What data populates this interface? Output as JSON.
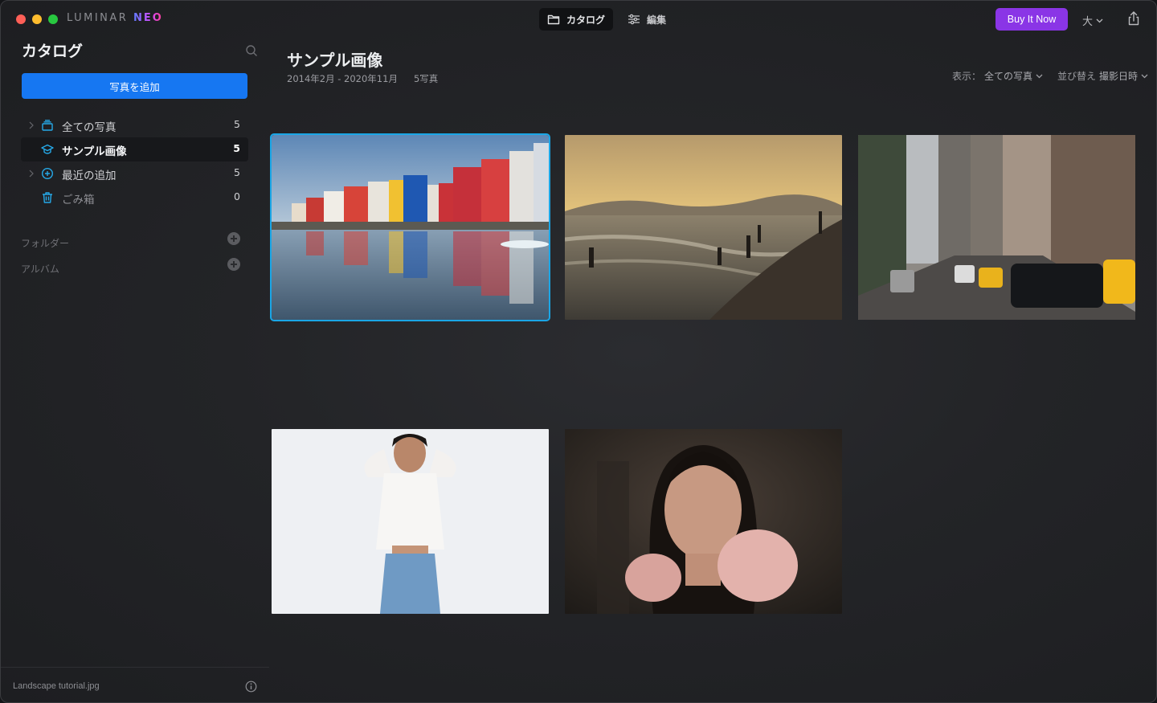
{
  "app": {
    "logo_main": "LUMINAR",
    "logo_neo": "NEO"
  },
  "toolbar": {
    "tabs": [
      {
        "label": "カタログ",
        "icon": "folder-icon",
        "active": true
      },
      {
        "label": "編集",
        "icon": "sliders-icon",
        "active": false
      }
    ],
    "buy_label": "Buy It Now",
    "size_label": "大"
  },
  "sidebar": {
    "title": "カタログ",
    "add_photo_label": "写真を追加",
    "items": [
      {
        "label": "全ての写真",
        "count": "5",
        "icon": "photos-stack-icon"
      },
      {
        "label": "サンプル画像",
        "count": "5",
        "icon": "graduation-cap-icon"
      },
      {
        "label": "最近の追加",
        "count": "5",
        "icon": "plus-circle-icon"
      },
      {
        "label": "ごみ箱",
        "count": "0",
        "icon": "trash-icon"
      }
    ],
    "sections": [
      {
        "label": "フォルダー"
      },
      {
        "label": "アルバム"
      }
    ],
    "footer_filename": "Landscape tutorial.jpg"
  },
  "main": {
    "album_title": "サンプル画像",
    "date_range": "2014年2月 - 2020年11月",
    "photo_count": "5写真",
    "view_label": "表示：",
    "view_value": "全ての写真",
    "sort_label": "並び替え",
    "sort_value": "撮影日時"
  },
  "colors": {
    "accent_blue": "#1677f2",
    "buy_purple": "#8a35e6",
    "selection": "#1aa6e6"
  }
}
